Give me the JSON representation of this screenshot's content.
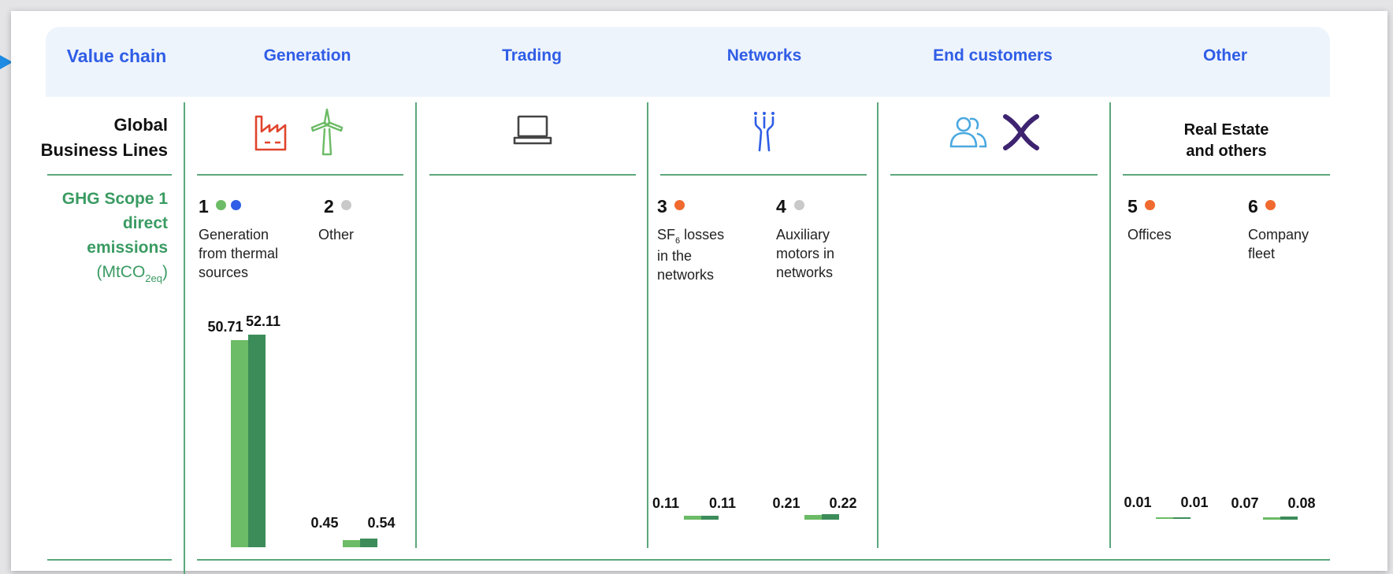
{
  "headers": {
    "value_chain": "Value chain",
    "generation": "Generation",
    "trading": "Trading",
    "networks": "Networks",
    "end_customers": "End customers",
    "other": "Other"
  },
  "row_labels": {
    "global_business_lines_1": "Global",
    "global_business_lines_2": "Business Lines",
    "ghg_1": "GHG Scope 1",
    "ghg_2": "direct",
    "ghg_3": "emissions",
    "ghg_unit_prefix": "(MtCO",
    "ghg_unit_sub": "2eq",
    "ghg_unit_suffix": ")"
  },
  "real_estate_label_1": "Real Estate",
  "real_estate_label_2": "and others",
  "icons": {
    "generation": [
      "factory-icon",
      "wind-turbine-icon"
    ],
    "trading": [
      "laptop-icon"
    ],
    "networks": [
      "power-pylon-icon"
    ],
    "end_customers": [
      "people-icon",
      "brand-x-icon"
    ]
  },
  "colors": {
    "header_text": "#2f5de6",
    "ghg_label": "#3a9b62",
    "bar_light": "#6cbb66",
    "bar_dark": "#3c8c5a",
    "divider": "#5ba77c",
    "dot_green": "#6cbb66",
    "dot_blue": "#2f5de6",
    "dot_gray": "#c9c9c9",
    "dot_orange": "#f06a30"
  },
  "chart_data": {
    "type": "bar",
    "categories": [
      "Generation from thermal sources",
      "Other",
      "SF6 losses in the networks",
      "Auxiliary motors in networks",
      "Offices",
      "Company fleet"
    ],
    "series": [
      {
        "values": [
          50.71,
          0.45,
          0.11,
          0.21,
          0.01,
          0.07
        ]
      },
      {
        "values": [
          52.11,
          0.54,
          0.11,
          0.22,
          0.01,
          0.08
        ]
      }
    ],
    "ylabel": "(MtCO2eq)"
  },
  "items": [
    {
      "number": "1",
      "desc_line1": "Generation",
      "desc_line2": "from thermal",
      "desc_line3": "sources",
      "v1": "50.71",
      "v2": "52.11"
    },
    {
      "number": "2",
      "desc_line1": "Other",
      "v1": "0.45",
      "v2": "0.54"
    },
    {
      "number": "3",
      "sf_prefix": "SF",
      "sf_sub": "6",
      "sf_suffix": " losses",
      "desc_line2": "in the",
      "desc_line3": "networks",
      "v1": "0.11",
      "v2": "0.11"
    },
    {
      "number": "4",
      "desc_line1": "Auxiliary",
      "desc_line2": "motors in",
      "desc_line3": "networks",
      "v1": "0.21",
      "v2": "0.22"
    },
    {
      "number": "5",
      "desc_line1": "Offices",
      "v1": "0.01",
      "v2": "0.01"
    },
    {
      "number": "6",
      "desc_line1": "Company",
      "desc_line2": "fleet",
      "v1": "0.07",
      "v2": "0.08"
    }
  ]
}
